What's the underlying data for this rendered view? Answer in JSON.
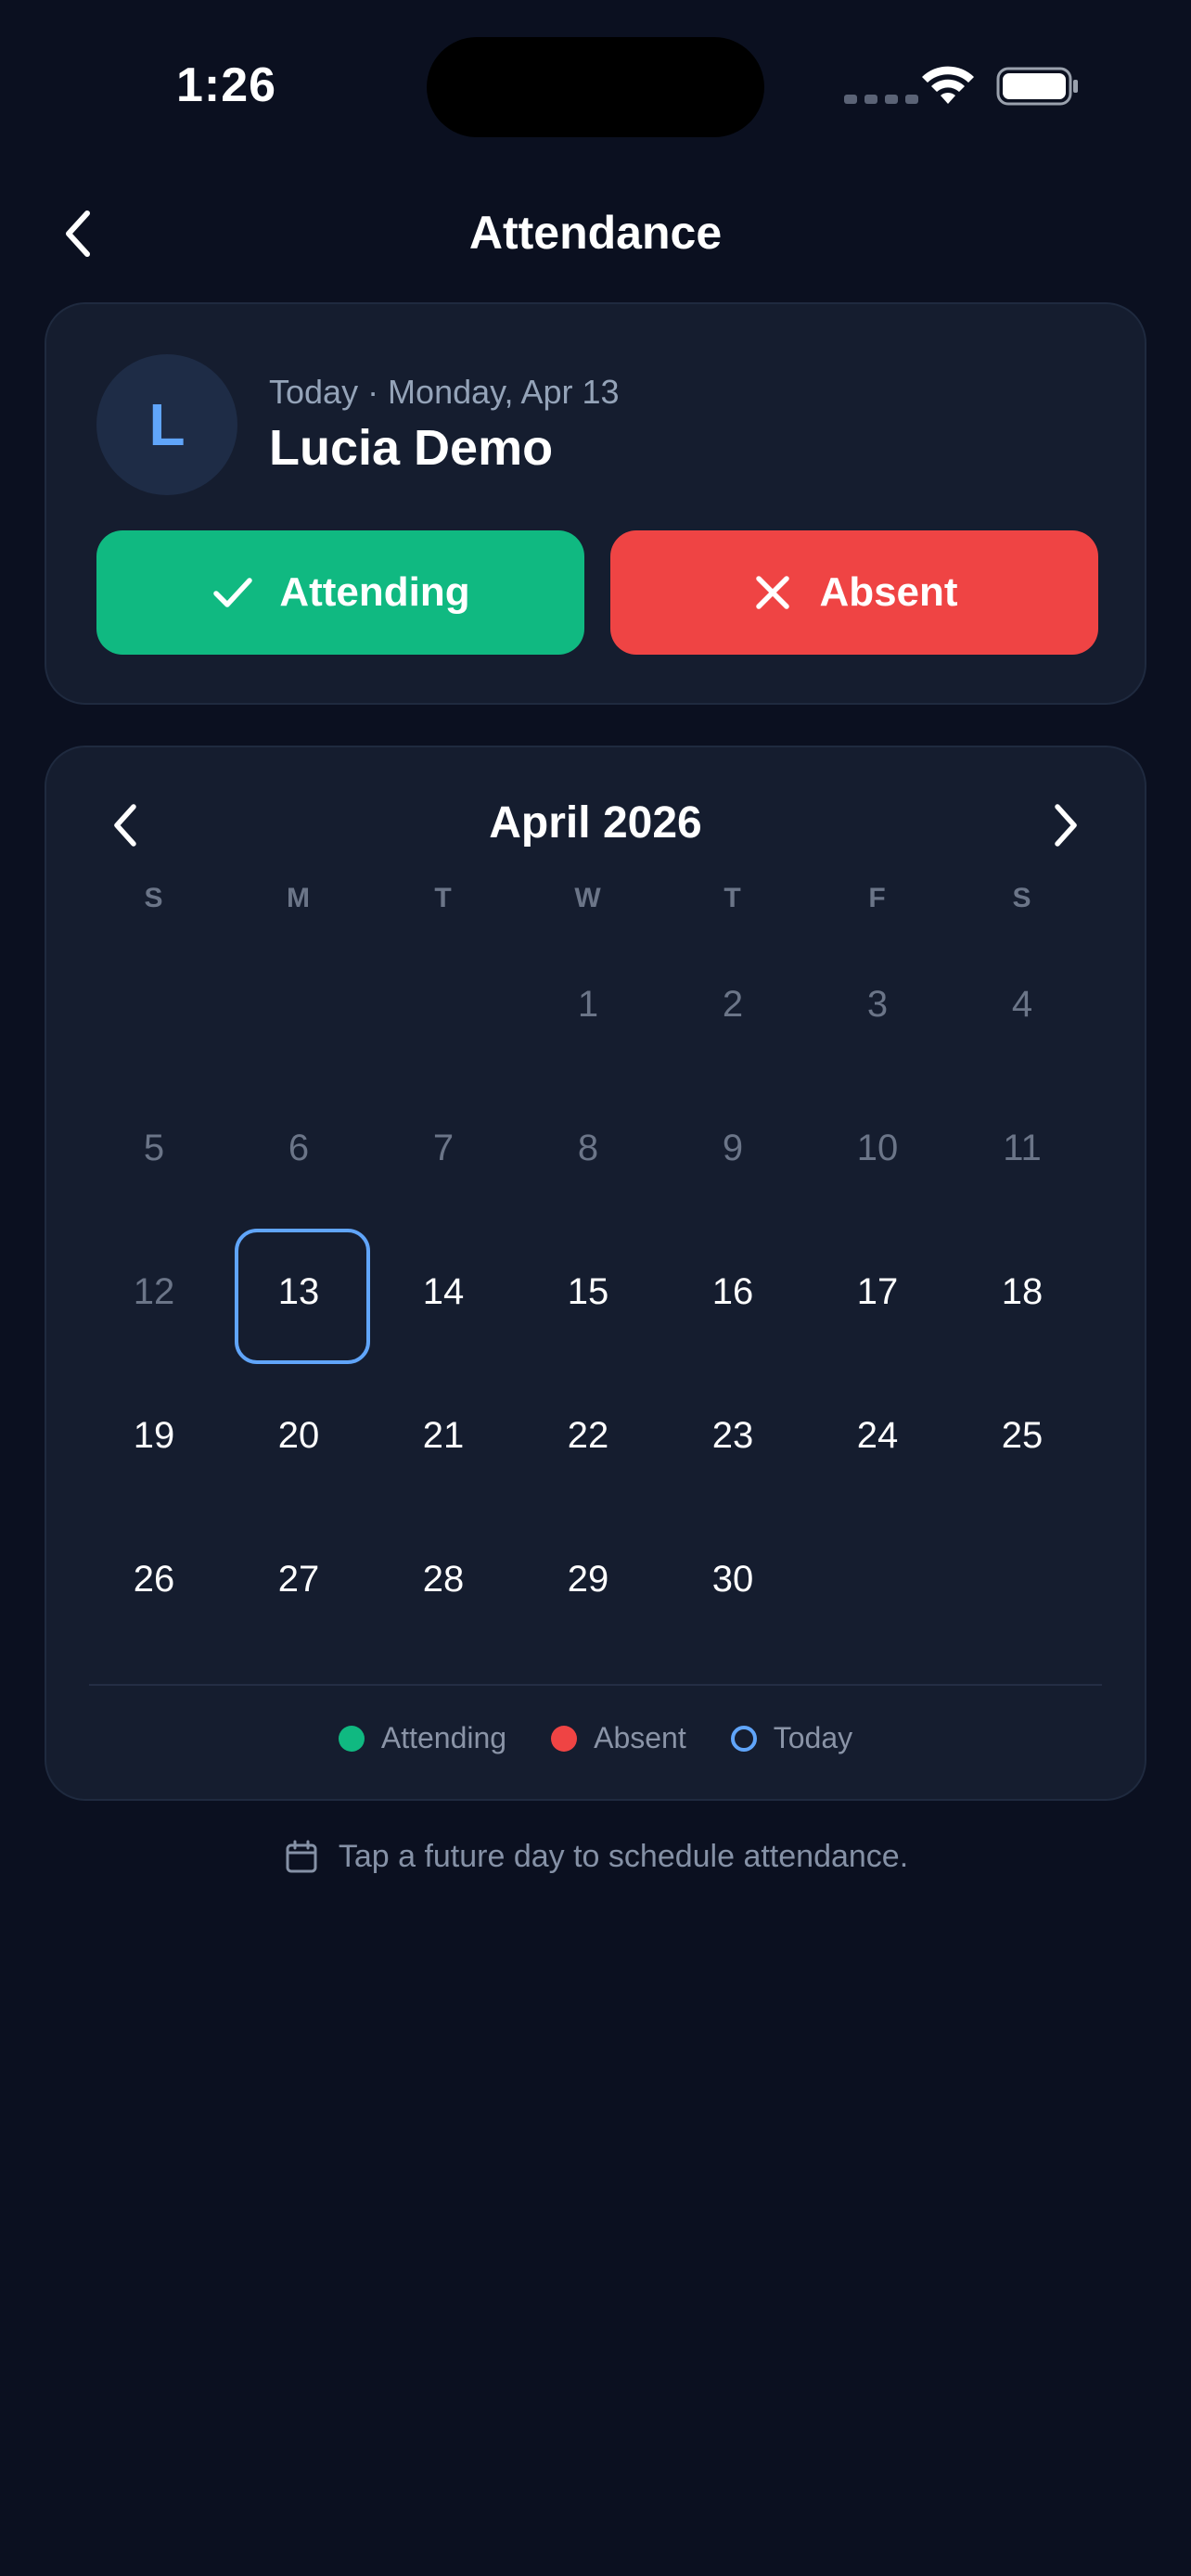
{
  "status_bar": {
    "time": "1:26"
  },
  "header": {
    "title": "Attendance"
  },
  "today_card": {
    "avatar_initial": "L",
    "date_label": "Today · Monday, Apr 13",
    "name": "Lucia Demo",
    "attending_label": "Attending",
    "absent_label": "Absent"
  },
  "calendar": {
    "month_title": "April 2026",
    "weekdays": [
      "S",
      "M",
      "T",
      "W",
      "T",
      "F",
      "S"
    ],
    "leading_blanks": 3,
    "days_in_month": 30,
    "today": 13,
    "legend": {
      "attending": "Attending",
      "absent": "Absent",
      "today": "Today"
    }
  },
  "hint": "Tap a future day to schedule attendance.",
  "colors": {
    "background": "#0b1020",
    "card": "#151d2f",
    "attending": "#10b981",
    "absent": "#ef4444",
    "today_ring": "#60a5fa",
    "muted_text": "#6b7588"
  },
  "icons": {
    "back": "chevron-left-icon",
    "prev_month": "chevron-left-icon",
    "next_month": "chevron-right-icon",
    "attending": "check-icon",
    "absent": "x-icon",
    "hint": "calendar-icon",
    "wifi": "wifi-icon",
    "battery": "battery-icon"
  }
}
